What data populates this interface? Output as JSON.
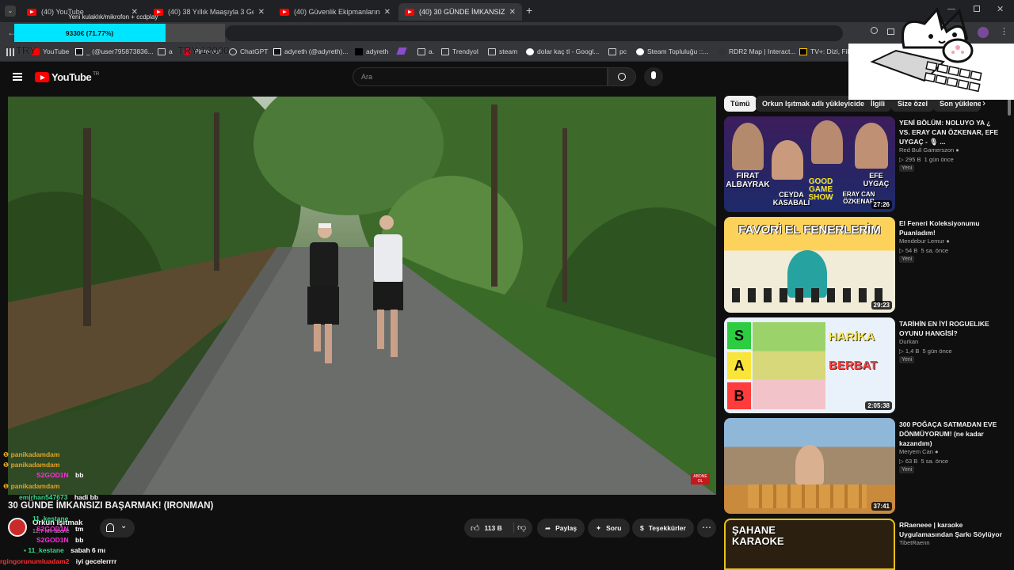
{
  "tabs": [
    {
      "title": "(40) YouTube"
    },
    {
      "title": "(40) 38 Yıllık Maaşıyla 3 Gece L..."
    },
    {
      "title": "(40) Güvenlik Ekipmanlarını Sınırl..."
    },
    {
      "title": "(40) 30 GÜNDE İMKANSIZI BAŞ..."
    }
  ],
  "overlay": {
    "notice": "Yeni kulaklık/mikrofon + ccdplay",
    "goal_text": "9330€ (71.77%)",
    "goal_fraction": 0.7177,
    "left_label": "TRY",
    "right_label": "TRY 13000"
  },
  "bookmarks": [
    "YouTube",
    "_ (@user795873836...",
    "a",
    "Pinterest",
    "ChatGPT",
    "adyreth (@adyreth)...",
    "adyreth",
    "a.",
    "Trendyol",
    "steam",
    "dolar kaç tl - Googl...",
    "pc",
    "Steam Topluluğu ::...",
    "RDR2 Map | Interact...",
    "TV+: Dizi, Film..."
  ],
  "youtube": {
    "logo": "YouTube",
    "region": "TR",
    "search_placeholder": "Ara"
  },
  "chips": [
    "Tümü",
    "Orkun Işıtmak adlı yükleyiciden",
    "İlgili",
    "Size özel",
    "Son yüklene..."
  ],
  "recommendations": [
    {
      "title": "YENİ BÖLÜM: NOLUYO YA ¿ VS. ERAY CAN ÖZKENAR, EFE UYGAÇ - 🎙 ...",
      "channel": "Red Bull Gamerszon",
      "views": "295 B",
      "age": "1 gün önce",
      "badge": "Yeni",
      "duration": "27:26",
      "thumb_text": [
        "FIRAT ALBAYRAK",
        "CEYDA KASABALI",
        "GOOD GAME SHOW",
        "EFE UYGAÇ",
        "ERAY CAN ÖZKENAR"
      ]
    },
    {
      "title": "El Feneri Koleksiyonumu Puanladım!",
      "channel": "Mendebur Lemur",
      "views": "54 B",
      "age": "5 sa. önce",
      "badge": "Yeni",
      "duration": "29:23",
      "thumb_text": [
        "FAVORİ EL FENERLERİM"
      ]
    },
    {
      "title": "TARİHİN EN İYİ ROGUELIKE OYUNU HANGİSİ?",
      "channel": "Durkan",
      "views": "1,4 B",
      "age": "5 gün önce",
      "badge": "Yeni",
      "duration": "2:05:38",
      "thumb_text": [
        "S",
        "A",
        "B",
        "HARİKA",
        "BERBAT"
      ]
    },
    {
      "title": "300 POĞAÇA SATMADAN EVE DÖNMÜYORUM! (ne kadar kazandım)",
      "channel": "Meryem Can",
      "views": "63 B",
      "age": "5 sa. önce",
      "badge": "Yeni",
      "duration": "37:41",
      "thumb_text": []
    },
    {
      "title": "RRaeneee | karaoke Uygulamasından Şarkı Söylüyor",
      "channel": "TibetRaenn",
      "views": "",
      "age": "",
      "badge": "",
      "duration": "",
      "thumb_text": [
        "ŞAHANE KARAOKE"
      ]
    }
  ],
  "video": {
    "title": "30 GÜNDE İMKANSIZI BAŞARMAK! (IRONMAN)",
    "channel": "Orkun Işıtmak",
    "subs": "12,7 Mn abone",
    "likes": "113 B",
    "share": "Paylaş",
    "ask": "Soru",
    "thanks": "Teşekkürler",
    "corner_badge": "ABONE OL"
  },
  "chat": [
    {
      "user": "panikadamdam",
      "msg": "",
      "color": "#e6a323"
    },
    {
      "user": "panikadamdam",
      "msg": "",
      "color": "#e6a323"
    },
    {
      "user": "S2GOD1N",
      "msg": "bb",
      "color": "#ff2de0"
    },
    {
      "user": "panikadamdam",
      "msg": "",
      "color": "#e6a323"
    },
    {
      "user": "emirhan547673",
      "msg": "hadi bb",
      "color": "#39d98a"
    },
    {
      "user": "11_kestane",
      "msg": "",
      "color": "#39d98a"
    },
    {
      "user": "S2GOD1N",
      "msg": "tm",
      "color": "#ff2de0"
    },
    {
      "user": "S2GOD1N",
      "msg": "bb",
      "color": "#ff2de0"
    },
    {
      "user": "11_kestane",
      "msg": "sabah 6 mı",
      "color": "#39d98a"
    },
    {
      "user": "rgingorunumluadam2",
      "msg": "iyi gecelerrrr",
      "color": "#ff2d2d"
    }
  ],
  "colors": {
    "accent": "#ff0000",
    "goal": "#00e5ff",
    "bg": "#0f0f0f"
  }
}
